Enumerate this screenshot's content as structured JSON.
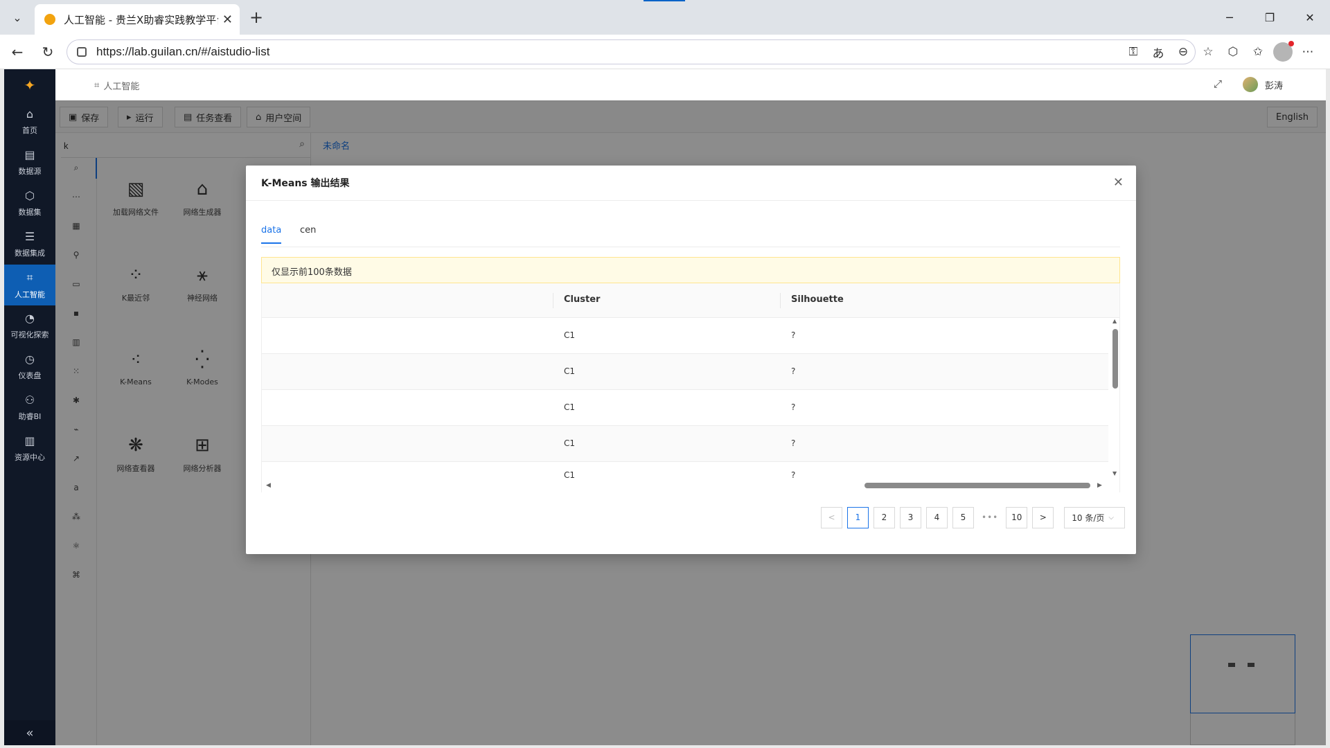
{
  "browser": {
    "tab_title": "人工智能 - 贵兰X助睿实践教学平台",
    "url": "https://lab.guilan.cn/#/aistudio-list",
    "icons": [
      "tab-list-icon",
      "close-icon",
      "plus-icon",
      "minimize-icon",
      "restore-icon",
      "close-window-icon",
      "back-icon",
      "reload-icon",
      "lock-icon",
      "key-icon",
      "translate-icon",
      "zoom-out-icon",
      "star-icon",
      "extensions-icon",
      "favorites-icon",
      "profile-icon",
      "more-icon"
    ]
  },
  "sidebar": {
    "items": [
      {
        "label": "首页",
        "icon": "home-icon"
      },
      {
        "label": "数据源",
        "icon": "database-icon"
      },
      {
        "label": "数据集",
        "icon": "cube-icon"
      },
      {
        "label": "数据集成",
        "icon": "stack-icon"
      },
      {
        "label": "人工智能",
        "icon": "ai-icon",
        "active": true
      },
      {
        "label": "可视化探索",
        "icon": "pie-icon"
      },
      {
        "label": "仪表盘",
        "icon": "gauge-icon"
      },
      {
        "label": "助睿BI",
        "icon": "org-icon"
      },
      {
        "label": "资源中心",
        "icon": "resource-icon"
      }
    ],
    "collapse": "«"
  },
  "header": {
    "breadcrumb": "人工智能",
    "username": "彭涛"
  },
  "toolbar": {
    "save": "保存",
    "run": "运行",
    "tasks": "任务查看",
    "userspace": "用户空间",
    "language": "English"
  },
  "search": {
    "value": "k"
  },
  "widgets": [
    {
      "label": "加载网络文件"
    },
    {
      "label": "网络生成器"
    },
    {
      "label": "K最近邻"
    },
    {
      "label": "神经网络"
    },
    {
      "label": "K-Means"
    },
    {
      "label": "K-Modes"
    },
    {
      "label": "网络查看器"
    },
    {
      "label": "网络分析器"
    }
  ],
  "doc_tab": "未命名",
  "modal": {
    "title": "K-Means 输出结果",
    "tabs": [
      "data",
      "cen"
    ],
    "notice": "仅显示前100条数据",
    "columns": [
      "Cluster",
      "Silhouette"
    ],
    "rows": [
      {
        "cluster": "C1",
        "silhouette": "?"
      },
      {
        "cluster": "C1",
        "silhouette": "?"
      },
      {
        "cluster": "C1",
        "silhouette": "?"
      },
      {
        "cluster": "C1",
        "silhouette": "?"
      },
      {
        "cluster": "C1",
        "silhouette": "?"
      }
    ],
    "pagination": {
      "prev": "<",
      "pages": [
        "1",
        "2",
        "3",
        "4",
        "5"
      ],
      "ellipsis": "•••",
      "last": "10",
      "next": ">",
      "page_size": "10 条/页",
      "current": 1
    }
  },
  "colors": {
    "accent": "#1a73e8",
    "sidebar_bg": "#101827",
    "sidebar_active": "#0e5eb3",
    "notice_bg": "#fffbe6"
  }
}
